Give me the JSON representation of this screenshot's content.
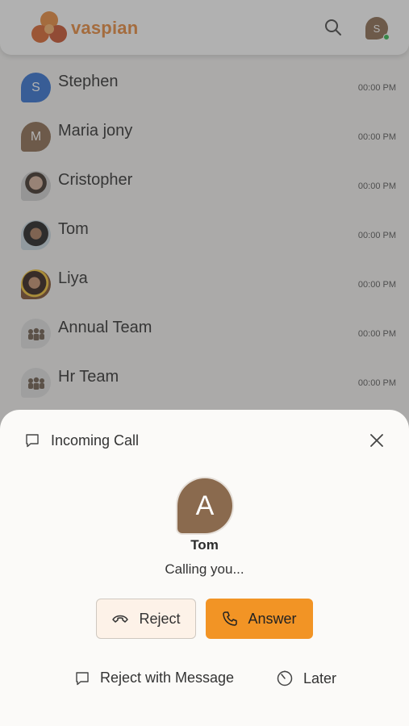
{
  "header": {
    "brand": "vaspian",
    "user_initial": "S"
  },
  "contacts": [
    {
      "initial": "S",
      "name": "Stephen",
      "time": "00:00 PM"
    },
    {
      "initial": "M",
      "name": "Maria jony",
      "time": "00:00 PM"
    },
    {
      "initial": "",
      "name": "Cristopher",
      "time": "00:00 PM"
    },
    {
      "initial": "",
      "name": "Tom",
      "time": "00:00 PM"
    },
    {
      "initial": "",
      "name": "Liya",
      "time": "00:00 PM"
    },
    {
      "initial": "",
      "name": "Annual Team",
      "time": "00:00 PM"
    },
    {
      "initial": "",
      "name": "Hr Team",
      "time": "00:00 PM"
    }
  ],
  "call_sheet": {
    "title": "Incoming Call",
    "caller_initial": "A",
    "caller_name": "Tom",
    "status": "Calling you...",
    "reject_label": "Reject",
    "answer_label": "Answer",
    "reject_message_label": "Reject with Message",
    "later_label": "Later"
  },
  "colors": {
    "accent": "#f29425",
    "brand": "#e9883a",
    "avatar_brown": "#8a6a4e",
    "avatar_blue": "#2f6fd1",
    "online": "#2fb94f"
  }
}
